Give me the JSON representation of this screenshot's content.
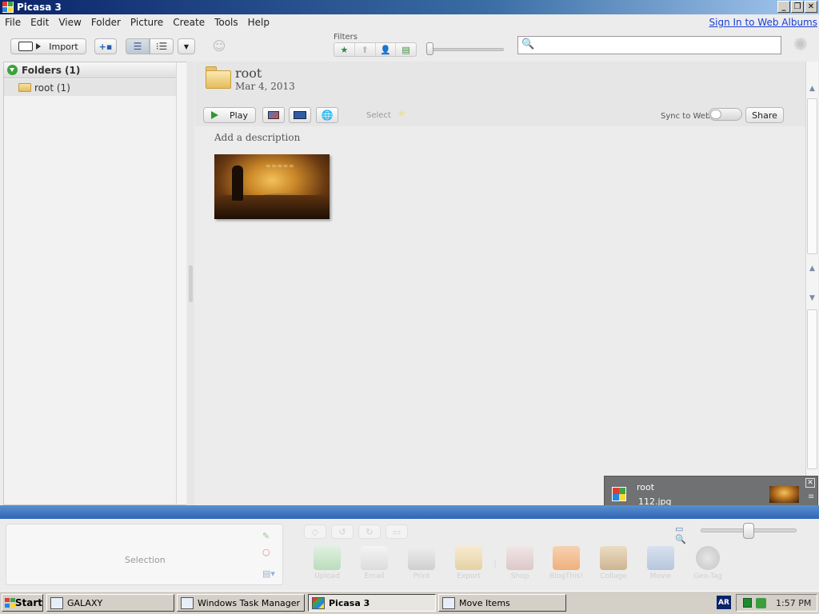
{
  "window": {
    "title": "Picasa 3",
    "minimize": "_",
    "restore": "❐",
    "close": "✕"
  },
  "menu": {
    "items": [
      "File",
      "Edit",
      "View",
      "Folder",
      "Picture",
      "Create",
      "Tools",
      "Help"
    ],
    "sign_in": "Sign In to Web Albums"
  },
  "toolbar": {
    "import_label": "Import",
    "filters_label": "Filters",
    "search_placeholder": ""
  },
  "left_panel": {
    "header": "Folders (1)",
    "folders": [
      {
        "label": "root (1)"
      }
    ]
  },
  "album": {
    "title": "root",
    "date": "Mar 4, 2013",
    "play_label": "Play",
    "select_label": "Select",
    "sync_label": "Sync to Web",
    "share_label": "Share",
    "description_placeholder": "Add a description"
  },
  "notification": {
    "title": "root",
    "file": "112.jpg"
  },
  "bottom": {
    "selection_label": "Selection",
    "actions": [
      "Upload",
      "Email",
      "Print",
      "Export",
      "Shop",
      "BlogThis!",
      "Collage",
      "Movie",
      "Geo-Tag"
    ]
  },
  "taskbar": {
    "start_label": "Start",
    "tasks": [
      {
        "label": "GALAXY"
      },
      {
        "label": "Windows Task Manager"
      },
      {
        "label": "Picasa 3"
      },
      {
        "label": "Move Items"
      }
    ],
    "language": "AR",
    "clock": "1:57 PM"
  },
  "colors": {
    "titlebar_start": "#0a246a",
    "divider": "#3a72c0",
    "link": "#1a3fd6",
    "green_accent": "#2f9a2f"
  }
}
